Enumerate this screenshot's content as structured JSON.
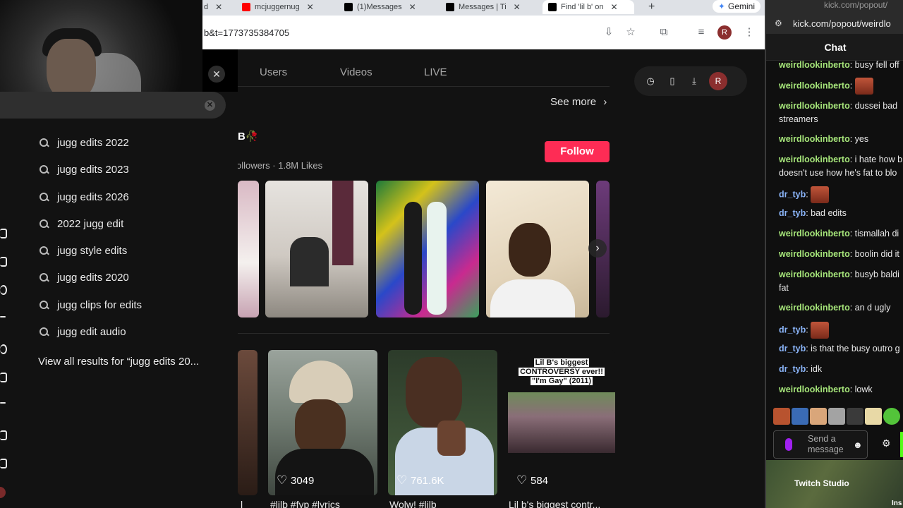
{
  "browser": {
    "tabs": [
      {
        "label": "d",
        "icon": "tab-icon",
        "color": "#dee1e6"
      },
      {
        "label": "mcjuggernug",
        "icon": "youtube-icon",
        "color": "#ff0000"
      },
      {
        "label": "(1)Messages",
        "icon": "tiktok-icon",
        "color": "#000000"
      },
      {
        "label": "Messages | Ti",
        "icon": "tiktok-icon",
        "color": "#000000"
      },
      {
        "label": "Find 'lil b' on",
        "icon": "tiktok-icon",
        "color": "#000000"
      }
    ],
    "new_tab": "+",
    "gemini_label": "Gemini",
    "url": "b&t=1773735384705",
    "profile_letter": "R"
  },
  "search": {
    "close_label": "✕",
    "clear_label": "✕",
    "suggestions": [
      "jugg edits 2022",
      "jugg edits 2023",
      "jugg edits 2026",
      "2022 jugg edit",
      "jugg style edits",
      "jugg edits 2020",
      "jugg clips for edits",
      "jugg edit audio"
    ],
    "view_all": "View all results for “jugg edits 20..."
  },
  "tiktok": {
    "tabs": [
      "Users",
      "Videos",
      "LIVE"
    ],
    "see_more": "See more",
    "username": "B🥀",
    "stats": "ollowers  ·  1.8M Likes",
    "follow_label": "Follow",
    "profile_letter": "R",
    "videos": [
      {
        "likes": "3049",
        "caption": "#lilb #fyp #lyrics"
      },
      {
        "likes": "761.6K",
        "caption": "Wolw! #lilb"
      },
      {
        "likes": "584",
        "caption": "Lil b's biggest contr..."
      }
    ],
    "thumbnail_text": [
      "Lil B's biggest",
      "CONTROVERSY ever!!",
      "\"I'm Gay\" (2011)"
    ],
    "left_caption": "l"
  },
  "chat": {
    "popout_url": "kick.com/popout/weirdlo",
    "faded_url": "kick.com/popout/",
    "header": "Chat",
    "messages": [
      {
        "user": "weirdlookinberto",
        "text": "busy fell off",
        "color": "green"
      },
      {
        "user": "weirdlookinberto",
        "text": "",
        "color": "green",
        "emote": true
      },
      {
        "user": "weirdlookinberto",
        "text": "dussei bad streamers",
        "color": "green"
      },
      {
        "user": "weirdlookinberto",
        "text": "yes",
        "color": "green"
      },
      {
        "user": "weirdlookinberto",
        "text": "i hate how b doesn't use how he's fat to blo",
        "color": "green"
      },
      {
        "user": "dr_tyb",
        "text": "",
        "color": "blue",
        "emote": true
      },
      {
        "user": "dr_tyb",
        "text": "bad edits",
        "color": "blue"
      },
      {
        "user": "weirdlookinberto",
        "text": "tismallah di",
        "color": "green"
      },
      {
        "user": "weirdlookinberto",
        "text": "boolin did it",
        "color": "green"
      },
      {
        "user": "weirdlookinberto",
        "text": "busyb baldi fat",
        "color": "green"
      },
      {
        "user": "weirdlookinberto",
        "text": "an d ugly",
        "color": "green"
      },
      {
        "user": "dr_tyb",
        "text": "",
        "color": "blue",
        "emote": true
      },
      {
        "user": "dr_tyb",
        "text": "is that the busy outro g",
        "color": "blue"
      },
      {
        "user": "dr_tyb",
        "text": "idk",
        "color": "blue"
      },
      {
        "user": "weirdlookinberto",
        "text": "lowk",
        "color": "green"
      }
    ],
    "send_placeholder": "Send a message",
    "twitch_studio": "Twitch Studio",
    "inst_label": "Ins"
  }
}
